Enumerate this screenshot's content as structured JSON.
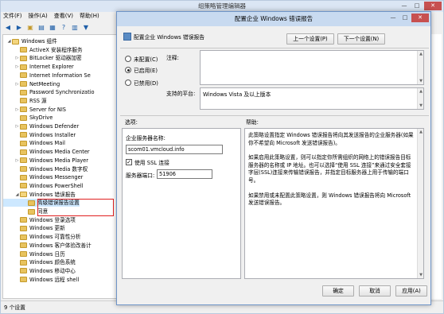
{
  "editor": {
    "title": "组策略管理编辑器",
    "menu": [
      "文件(F)",
      "操作(A)",
      "查看(V)",
      "帮助(H)"
    ],
    "status": "9 个设置",
    "tree": [
      {
        "label": "Windows 组件",
        "indent": 0,
        "open": true,
        "arrow": "◢"
      },
      {
        "label": "ActiveX 安装程序服务",
        "indent": 1
      },
      {
        "label": "BitLocker 驱动器加密",
        "indent": 1,
        "arrow": "▷"
      },
      {
        "label": "Internet Explorer",
        "indent": 1,
        "arrow": "▷"
      },
      {
        "label": "Internet Information Se",
        "indent": 1
      },
      {
        "label": "NetMeeting",
        "indent": 1,
        "arrow": "▷"
      },
      {
        "label": "Password Synchronizatio",
        "indent": 1
      },
      {
        "label": "RSS 源",
        "indent": 1
      },
      {
        "label": "Server for NIS",
        "indent": 1,
        "arrow": "▷"
      },
      {
        "label": "SkyDrive",
        "indent": 1
      },
      {
        "label": "Windows Defender",
        "indent": 1,
        "arrow": "▷"
      },
      {
        "label": "Windows Installer",
        "indent": 1
      },
      {
        "label": "Windows Mail",
        "indent": 1
      },
      {
        "label": "Windows Media Center",
        "indent": 1
      },
      {
        "label": "Windows Media Player",
        "indent": 1,
        "arrow": "▷"
      },
      {
        "label": "Windows Media 数字权",
        "indent": 1
      },
      {
        "label": "Windows Messenger",
        "indent": 1
      },
      {
        "label": "Windows PowerShell",
        "indent": 1
      },
      {
        "label": "Windows 错误报告",
        "indent": 1,
        "open": true,
        "arrow": "◢"
      },
      {
        "label": "高级错误报告设置",
        "indent": 2,
        "selected": true
      },
      {
        "label": "同意",
        "indent": 2
      },
      {
        "label": "Windows 登录选项",
        "indent": 1
      },
      {
        "label": "Windows 更新",
        "indent": 1
      },
      {
        "label": "Windows 可靠性分析",
        "indent": 1
      },
      {
        "label": "Windows 客户体验改善计",
        "indent": 1
      },
      {
        "label": "Windows 日历",
        "indent": 1
      },
      {
        "label": "Windows 颜色系统",
        "indent": 1
      },
      {
        "label": "Windows 移动中心",
        "indent": 1
      },
      {
        "label": "Windows 远程 shell",
        "indent": 1
      }
    ]
  },
  "dialog": {
    "title": "配置企业 Windows 错误报告",
    "setting_name": "配置企业 Windows 错误报告",
    "prev_button": "上一个设置(P)",
    "next_button": "下一个设置(N)",
    "options": [
      {
        "label": "未配置(C)",
        "checked": false
      },
      {
        "label": "已启用(E)",
        "checked": true
      },
      {
        "label": "已禁用(D)",
        "checked": false
      }
    ],
    "comment_label": "注释:",
    "platform_label": "支持的平台:",
    "platform_value": "Windows Vista 及以上版本",
    "options_label": "选项:",
    "help_label": "帮助:",
    "server_name_label": "企业服务器名称:",
    "server_name_value": "scom01.vmcloud.info",
    "ssl_label": "使用 SSL 连接",
    "ssl_checked": true,
    "port_label": "服务器端口:",
    "port_value": "51906",
    "help_paragraphs": [
      "此策略设置指定 Windows 错误报告将向其发送报告的企业服务器(如果你不希望向 Microsoft 发送错误报告)。",
      "如果启用此策略设置，则可以指定你所需组织的网络上的错误报告目标服务器的名称或 IP 地址。也可以选择“使用 SSL 连接”来通过安全套接字层(SSL)连接来传输错误报告，并指定目标服务器上用于传输的端口号。",
      "如果禁用或未配置此策略设置，则 Windows 错误报告将向 Microsoft 发送错误报告。"
    ],
    "ok_button": "确定",
    "cancel_button": "取消",
    "apply_button": "应用(A)"
  }
}
